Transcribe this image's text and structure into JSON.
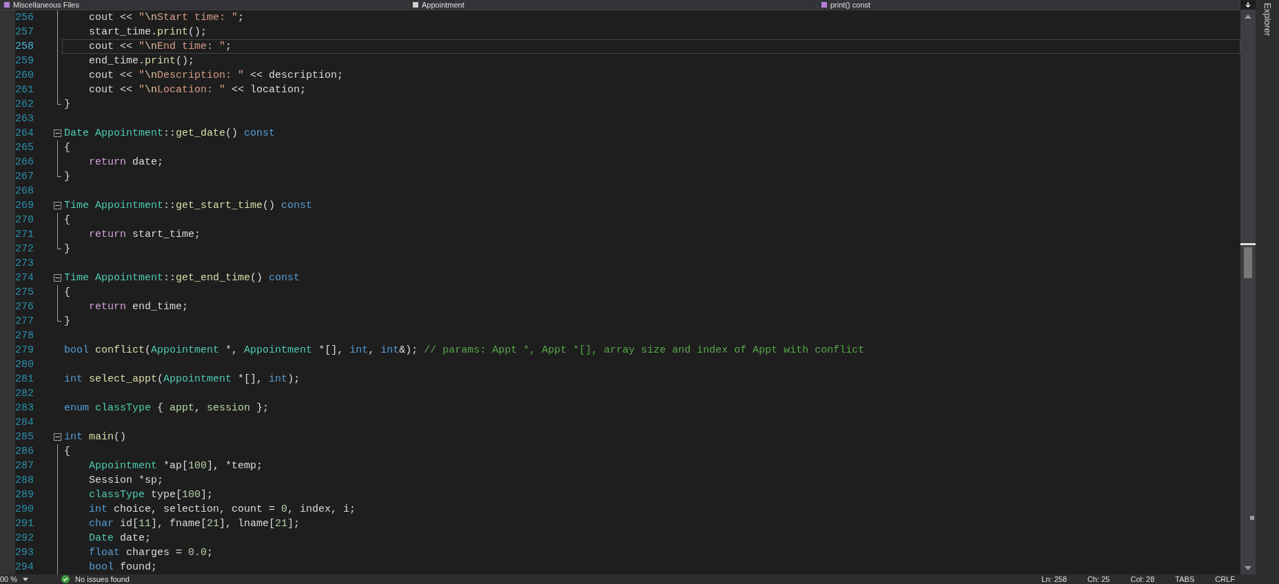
{
  "navigation_bar": [
    {
      "kind": "project",
      "label": "Miscellaneous Files"
    },
    {
      "kind": "scope",
      "label": "Appointment"
    },
    {
      "kind": "member",
      "label": "print() const"
    }
  ],
  "editor": {
    "lines": [
      {
        "num": "256",
        "kind": "body",
        "current": false,
        "tokens": [
          {
            "kind": "plain",
            "text": "    cout << "
          },
          {
            "kind": "str",
            "text": "\""
          },
          {
            "kind": "esc",
            "text": "\\n"
          },
          {
            "kind": "str",
            "text": "Start time: \""
          },
          {
            "kind": "plain",
            "text": ";"
          }
        ]
      },
      {
        "num": "257",
        "kind": "body",
        "current": false,
        "tokens": [
          {
            "kind": "plain",
            "text": "    start_time."
          },
          {
            "kind": "fn",
            "text": "print"
          },
          {
            "kind": "plain",
            "text": "();"
          }
        ]
      },
      {
        "num": "258",
        "kind": "body",
        "current": true,
        "tokens": [
          {
            "kind": "plain",
            "text": "    cout << "
          },
          {
            "kind": "str",
            "text": "\""
          },
          {
            "kind": "esc",
            "text": "\\n"
          },
          {
            "kind": "str",
            "text": "End time: \""
          },
          {
            "kind": "plain",
            "text": ";"
          }
        ]
      },
      {
        "num": "259",
        "kind": "body",
        "current": false,
        "tokens": [
          {
            "kind": "plain",
            "text": "    end_time."
          },
          {
            "kind": "fn",
            "text": "print"
          },
          {
            "kind": "plain",
            "text": "();"
          }
        ]
      },
      {
        "num": "260",
        "kind": "body",
        "current": false,
        "tokens": [
          {
            "kind": "plain",
            "text": "    cout << "
          },
          {
            "kind": "str",
            "text": "\""
          },
          {
            "kind": "esc",
            "text": "\\n"
          },
          {
            "kind": "str",
            "text": "Description: \""
          },
          {
            "kind": "plain",
            "text": " << description;"
          }
        ]
      },
      {
        "num": "261",
        "kind": "body",
        "current": false,
        "tokens": [
          {
            "kind": "plain",
            "text": "    cout << "
          },
          {
            "kind": "str",
            "text": "\""
          },
          {
            "kind": "esc",
            "text": "\\n"
          },
          {
            "kind": "str",
            "text": "Location: \""
          },
          {
            "kind": "plain",
            "text": " << location;"
          }
        ]
      },
      {
        "num": "262",
        "kind": "end",
        "current": false,
        "tokens": [
          {
            "kind": "plain",
            "text": "}"
          }
        ]
      },
      {
        "num": "263",
        "kind": "plain",
        "current": false
      },
      {
        "num": "264",
        "kind": "start",
        "current": false,
        "tokens": [
          {
            "kind": "type",
            "text": "Date"
          },
          {
            "kind": "type",
            "text": " Appointment"
          },
          {
            "kind": "plain",
            "text": "::"
          },
          {
            "kind": "fn",
            "text": "get_date"
          },
          {
            "kind": "plain",
            "text": "() "
          },
          {
            "kind": "kw",
            "text": "const"
          }
        ]
      },
      {
        "num": "265",
        "kind": "body",
        "current": false,
        "tokens": [
          {
            "kind": "plain",
            "text": "{"
          }
        ]
      },
      {
        "num": "266",
        "kind": "body",
        "current": false,
        "tokens": [
          {
            "kind": "ctl",
            "text": "    return"
          },
          {
            "kind": "plain",
            "text": " date;"
          }
        ]
      },
      {
        "num": "267",
        "kind": "end",
        "current": false,
        "tokens": [
          {
            "kind": "plain",
            "text": "}"
          }
        ]
      },
      {
        "num": "268",
        "kind": "plain",
        "current": false
      },
      {
        "num": "269",
        "kind": "start",
        "current": false,
        "tokens": [
          {
            "kind": "type",
            "text": "Time"
          },
          {
            "kind": "type",
            "text": " Appointment"
          },
          {
            "kind": "plain",
            "text": "::"
          },
          {
            "kind": "fn",
            "text": "get_start_time"
          },
          {
            "kind": "plain",
            "text": "() "
          },
          {
            "kind": "kw",
            "text": "const"
          }
        ]
      },
      {
        "num": "270",
        "kind": "body",
        "current": false,
        "tokens": [
          {
            "kind": "plain",
            "text": "{"
          }
        ]
      },
      {
        "num": "271",
        "kind": "body",
        "current": false,
        "tokens": [
          {
            "kind": "ctl",
            "text": "    return"
          },
          {
            "kind": "plain",
            "text": " start_time;"
          }
        ]
      },
      {
        "num": "272",
        "kind": "end",
        "current": false,
        "tokens": [
          {
            "kind": "plain",
            "text": "}"
          }
        ]
      },
      {
        "num": "273",
        "kind": "plain",
        "current": false
      },
      {
        "num": "274",
        "kind": "start",
        "current": false,
        "tokens": [
          {
            "kind": "type",
            "text": "Time"
          },
          {
            "kind": "type",
            "text": " Appointment"
          },
          {
            "kind": "plain",
            "text": "::"
          },
          {
            "kind": "fn",
            "text": "get_end_time"
          },
          {
            "kind": "plain",
            "text": "() "
          },
          {
            "kind": "kw",
            "text": "const"
          }
        ]
      },
      {
        "num": "275",
        "kind": "body",
        "current": false,
        "tokens": [
          {
            "kind": "plain",
            "text": "{"
          }
        ]
      },
      {
        "num": "276",
        "kind": "body",
        "current": false,
        "tokens": [
          {
            "kind": "ctl",
            "text": "    return"
          },
          {
            "kind": "plain",
            "text": " end_time;"
          }
        ]
      },
      {
        "num": "277",
        "kind": "end",
        "current": false,
        "tokens": [
          {
            "kind": "plain",
            "text": "}"
          }
        ]
      },
      {
        "num": "278",
        "kind": "plain",
        "current": false
      },
      {
        "num": "279",
        "kind": "plain",
        "current": false,
        "tokens": [
          {
            "kind": "kw",
            "text": "bool"
          },
          {
            "kind": "fn",
            "text": " conflict"
          },
          {
            "kind": "plain",
            "text": "("
          },
          {
            "kind": "type",
            "text": "Appointment"
          },
          {
            "kind": "plain",
            "text": " *, "
          },
          {
            "kind": "type",
            "text": "Appointment"
          },
          {
            "kind": "plain",
            "text": " *[], "
          },
          {
            "kind": "kw",
            "text": "int"
          },
          {
            "kind": "plain",
            "text": ", "
          },
          {
            "kind": "kw",
            "text": "int"
          },
          {
            "kind": "plain",
            "text": "&); "
          },
          {
            "kind": "cm",
            "text": "// params: Appt *, Appt *[], array size and index of Appt with conflict"
          }
        ]
      },
      {
        "num": "280",
        "kind": "plain",
        "current": false
      },
      {
        "num": "281",
        "kind": "plain",
        "current": false,
        "tokens": [
          {
            "kind": "kw",
            "text": "int"
          },
          {
            "kind": "fn",
            "text": " select_appt"
          },
          {
            "kind": "plain",
            "text": "("
          },
          {
            "kind": "type",
            "text": "Appointment"
          },
          {
            "kind": "plain",
            "text": " *[], "
          },
          {
            "kind": "kw",
            "text": "int"
          },
          {
            "kind": "plain",
            "text": ");"
          }
        ]
      },
      {
        "num": "282",
        "kind": "plain",
        "current": false
      },
      {
        "num": "283",
        "kind": "plain",
        "current": false,
        "tokens": [
          {
            "kind": "kw",
            "text": "enum"
          },
          {
            "kind": "type",
            "text": " classType"
          },
          {
            "kind": "plain",
            "text": " { "
          },
          {
            "kind": "enum",
            "text": "appt"
          },
          {
            "kind": "plain",
            "text": ", "
          },
          {
            "kind": "enum",
            "text": "session"
          },
          {
            "kind": "plain",
            "text": " };"
          }
        ]
      },
      {
        "num": "284",
        "kind": "plain",
        "current": false
      },
      {
        "num": "285",
        "kind": "start",
        "current": false,
        "tokens": [
          {
            "kind": "kw",
            "text": "int"
          },
          {
            "kind": "fn",
            "text": " main"
          },
          {
            "kind": "plain",
            "text": "()"
          }
        ]
      },
      {
        "num": "286",
        "kind": "body",
        "current": false,
        "tokens": [
          {
            "kind": "plain",
            "text": "{"
          }
        ]
      },
      {
        "num": "287",
        "kind": "body",
        "current": false,
        "tokens": [
          {
            "kind": "type",
            "text": "    Appointment"
          },
          {
            "kind": "plain",
            "text": " *ap["
          },
          {
            "kind": "num",
            "text": "100"
          },
          {
            "kind": "plain",
            "text": "], *temp;"
          }
        ]
      },
      {
        "num": "288",
        "kind": "body",
        "current": false,
        "tokens": [
          {
            "kind": "plain",
            "text": "    Session *sp;"
          }
        ]
      },
      {
        "num": "289",
        "kind": "body",
        "current": false,
        "tokens": [
          {
            "kind": "type",
            "text": "    classType"
          },
          {
            "kind": "plain",
            "text": " type["
          },
          {
            "kind": "num",
            "text": "100"
          },
          {
            "kind": "plain",
            "text": "];"
          }
        ]
      },
      {
        "num": "290",
        "kind": "body",
        "current": false,
        "tokens": [
          {
            "kind": "kw",
            "text": "    int"
          },
          {
            "kind": "plain",
            "text": " choice, selection, count = "
          },
          {
            "kind": "num",
            "text": "0"
          },
          {
            "kind": "plain",
            "text": ", index, i;"
          }
        ]
      },
      {
        "num": "291",
        "kind": "body",
        "current": false,
        "tokens": [
          {
            "kind": "kw",
            "text": "    char"
          },
          {
            "kind": "plain",
            "text": " id["
          },
          {
            "kind": "num",
            "text": "11"
          },
          {
            "kind": "plain",
            "text": "], fname["
          },
          {
            "kind": "num",
            "text": "21"
          },
          {
            "kind": "plain",
            "text": "], lname["
          },
          {
            "kind": "num",
            "text": "21"
          },
          {
            "kind": "plain",
            "text": "];"
          }
        ]
      },
      {
        "num": "292",
        "kind": "body",
        "current": false,
        "tokens": [
          {
            "kind": "type",
            "text": "    Date"
          },
          {
            "kind": "plain",
            "text": " date;"
          }
        ]
      },
      {
        "num": "293",
        "kind": "body",
        "current": false,
        "tokens": [
          {
            "kind": "kw",
            "text": "    float"
          },
          {
            "kind": "plain",
            "text": " charges = "
          },
          {
            "kind": "num",
            "text": "0.0"
          },
          {
            "kind": "plain",
            "text": ";"
          }
        ]
      },
      {
        "num": "294",
        "kind": "body",
        "current": false,
        "tokens": [
          {
            "kind": "kw",
            "text": "    bool"
          },
          {
            "kind": "plain",
            "text": " found;"
          }
        ]
      }
    ]
  },
  "side_panel": {
    "label": "Explorer"
  },
  "status_bar": {
    "zoom": "00 %",
    "issues": "No issues found",
    "line": "Ln: 258",
    "char": "Ch: 25",
    "col": "Col: 28",
    "indent": "TABS",
    "eol": "CRLF"
  }
}
